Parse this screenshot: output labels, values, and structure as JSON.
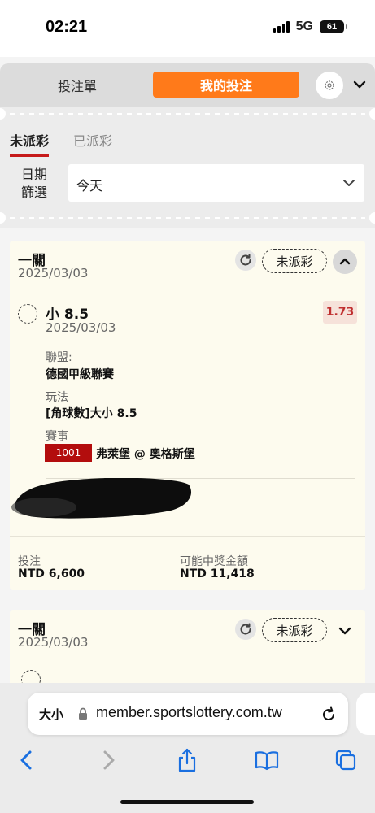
{
  "status_bar": {
    "time": "02:21",
    "network": "5G",
    "battery": "61"
  },
  "header": {
    "betslip_tab": "投注單",
    "mybets_tab": "我的投注",
    "settings_icon": "gear-icon",
    "menu_icon": "chevron-down-icon"
  },
  "filter": {
    "tabs": [
      {
        "label": "未派彩",
        "active": true
      },
      {
        "label": "已派彩",
        "active": false
      }
    ],
    "date_label": "日期篩選",
    "date_value": "今天"
  },
  "bets": [
    {
      "type": "一關",
      "date": "2025/03/03",
      "status": "未派彩",
      "selection": "小 8.5",
      "selection_date": "2025/03/03",
      "odds": "1.73",
      "league_label": "聯盟:",
      "league": "德國甲級聯賽",
      "market_label": "玩法",
      "market": "[角球數]大小 8.5",
      "event_label": "賽事",
      "event_code": "1001",
      "event": "弗萊堡 @ 奧格斯堡",
      "stake_label": "投注",
      "stake": "NTD 6,600",
      "payout_label": "可能中獎金額",
      "payout": "NTD 11,418"
    },
    {
      "type": "一關",
      "date": "2025/03/03",
      "status": "未派彩"
    }
  ],
  "browser": {
    "text_size": "大小",
    "url": "member.sportslottery.com.tw"
  },
  "colors": {
    "accent": "#ff7a1a",
    "active_underline": "#c61a1a",
    "event_code_bg": "#b30d0d",
    "odds_text": "#c03030",
    "card_bg": "#fdfbee"
  }
}
